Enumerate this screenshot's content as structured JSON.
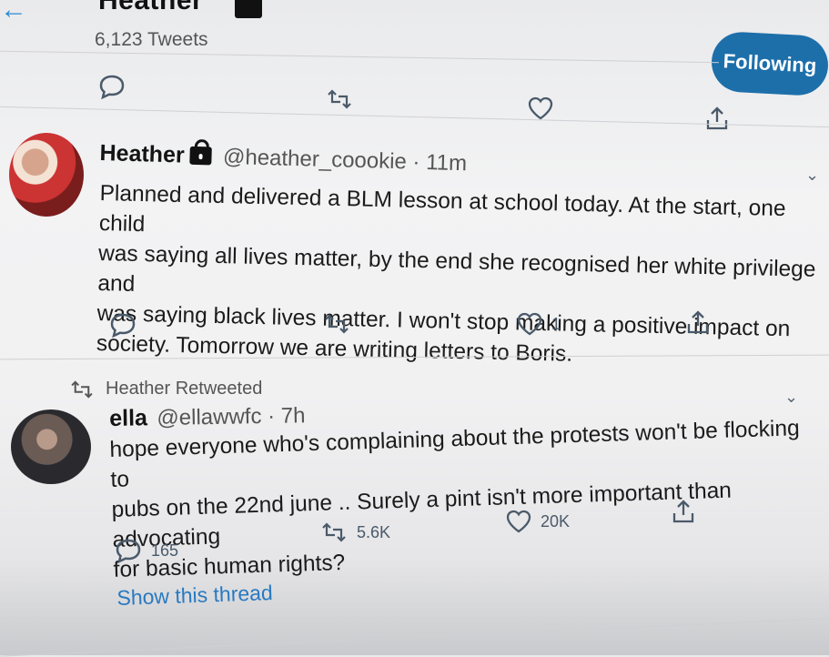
{
  "header": {
    "name": "Heather",
    "tweet_count": "6,123 Tweets",
    "follow_label": "Following"
  },
  "tweet1": {
    "name": "Heather",
    "handle": "@heather_coookie · 11m",
    "lines": [
      "Planned and delivered a BLM lesson at school today. At the start, one child",
      "was saying all lives matter, by the end she recognised her white privilege and",
      "was saying black lives matter. I won't stop making a positive impact on",
      "society. Tomorrow we are writing letters to Boris."
    ],
    "likes": "1"
  },
  "tweet2": {
    "retweet_label": "Heather Retweeted",
    "name": "ella",
    "handle": "@ellawwfc · 7h",
    "lines": [
      "hope everyone who's complaining about the protests won't be flocking to",
      "pubs on the 22nd june .. Surely a pint isn't more important than advocating",
      "for basic human rights?"
    ],
    "replies": "165",
    "retweets": "5.6K",
    "likes": "20K",
    "show_thread": "Show this thread"
  },
  "colors": {
    "accent": "#1d6faa",
    "link": "#2a7ac0"
  }
}
